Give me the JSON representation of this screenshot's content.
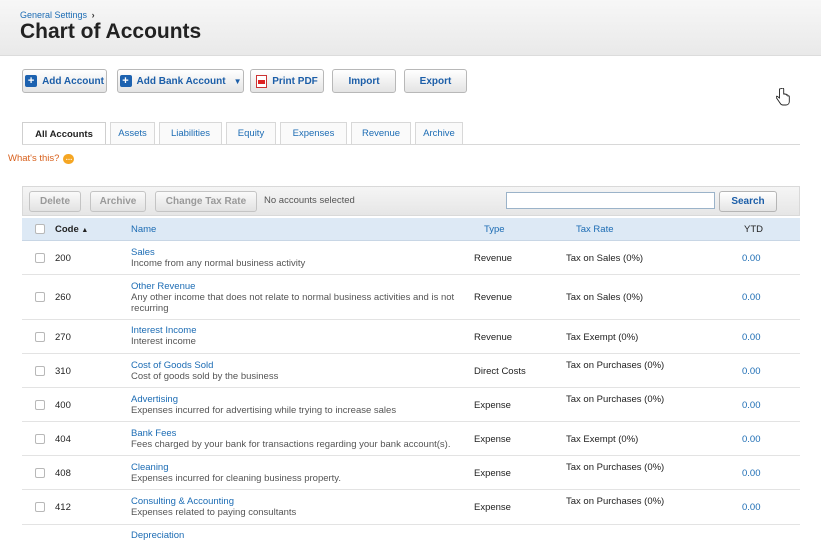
{
  "header": {
    "breadcrumb": "General Settings",
    "breadcrumb_arrow": "›",
    "title": "Chart of Accounts"
  },
  "toolbar": {
    "add_account": "Add Account",
    "add_bank_account": "Add Bank Account",
    "print_pdf": "Print PDF",
    "import": "Import",
    "export": "Export"
  },
  "tabs": [
    "All Accounts",
    "Assets",
    "Liabilities",
    "Equity",
    "Expenses",
    "Revenue",
    "Archive"
  ],
  "active_tab": "All Accounts",
  "help": {
    "whats_this": "What's this?"
  },
  "grid_toolbar": {
    "delete": "Delete",
    "archive": "Archive",
    "change_tax_rate": "Change Tax Rate",
    "selection_status": "No accounts selected",
    "search_button": "Search",
    "search_value": ""
  },
  "columns": {
    "code": "Code",
    "sort_indicator": "▲",
    "name": "Name",
    "type": "Type",
    "tax_rate": "Tax Rate",
    "ytd": "YTD"
  },
  "rows": [
    {
      "code": "200",
      "name": "Sales",
      "desc": "Income from any normal business activity",
      "type": "Revenue",
      "tax": "Tax on Sales (0%)",
      "ytd": "0.00"
    },
    {
      "code": "260",
      "name": "Other Revenue",
      "desc": "Any other income that does not relate to normal business activities and is not recurring",
      "type": "Revenue",
      "tax": "Tax on Sales (0%)",
      "ytd": "0.00"
    },
    {
      "code": "270",
      "name": "Interest Income",
      "desc": "Interest income",
      "type": "Revenue",
      "tax": "Tax Exempt (0%)",
      "ytd": "0.00"
    },
    {
      "code": "310",
      "name": "Cost of Goods Sold",
      "desc": "Cost of goods sold by the business",
      "type": "Direct Costs",
      "tax": "Tax on Purchases (0%)",
      "ytd": "0.00"
    },
    {
      "code": "400",
      "name": "Advertising",
      "desc": "Expenses incurred for advertising while trying to increase sales",
      "type": "Expense",
      "tax": "Tax on Purchases (0%)",
      "ytd": "0.00"
    },
    {
      "code": "404",
      "name": "Bank Fees",
      "desc": "Fees charged by your bank for transactions regarding your bank account(s).",
      "type": "Expense",
      "tax": "Tax Exempt (0%)",
      "ytd": "0.00"
    },
    {
      "code": "408",
      "name": "Cleaning",
      "desc": "Expenses incurred for cleaning business property.",
      "type": "Expense",
      "tax": "Tax on Purchases (0%)",
      "ytd": "0.00"
    },
    {
      "code": "412",
      "name": "Consulting & Accounting",
      "desc": "Expenses related to paying consultants",
      "type": "Expense",
      "tax": "Tax on Purchases (0%)",
      "ytd": "0.00"
    },
    {
      "code": "",
      "name": "Depreciation",
      "desc": "",
      "type": "",
      "tax": "",
      "ytd": ""
    }
  ],
  "colors": {
    "link": "#1c6cb4",
    "header_bg": "#dde9f5",
    "help_orange": "#d8601c"
  }
}
